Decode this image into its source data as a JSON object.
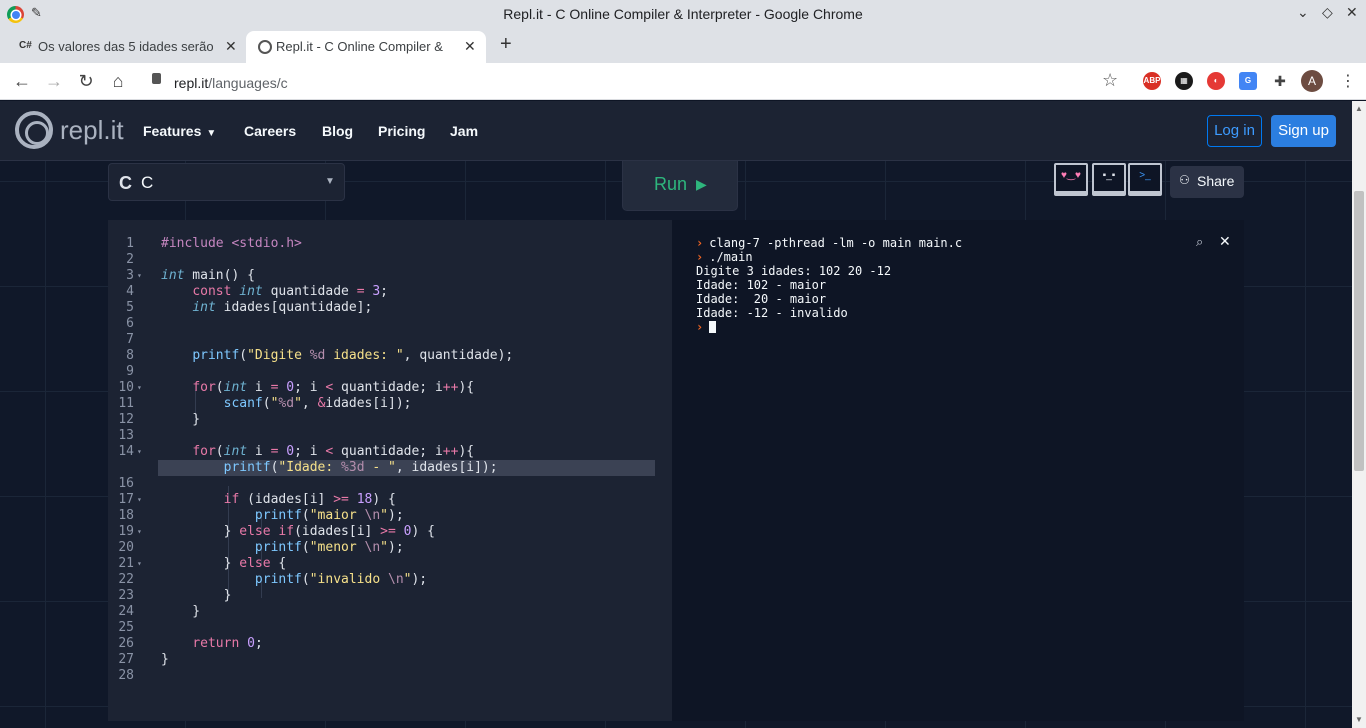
{
  "window": {
    "title": "Repl.it - C Online Compiler & Interpreter - Google Chrome"
  },
  "tabs": [
    {
      "label": "Os valores das 5 idades serão",
      "favicon": "C#"
    },
    {
      "label": "Repl.it - C Online Compiler & I"
    }
  ],
  "address": {
    "host": "repl.it",
    "path": "/languages/c"
  },
  "header": {
    "logo_text": "repl.it",
    "nav": [
      "Features",
      "Careers",
      "Blog",
      "Pricing",
      "Jam"
    ],
    "login": "Log in",
    "signup": "Sign up"
  },
  "toolbar": {
    "language": "C",
    "run": "Run",
    "share": "Share"
  },
  "colors": {
    "accent": "#0079f2",
    "run": "#2eb67d",
    "prompt": "#f26522"
  },
  "editor": {
    "lines": [
      "#include <stdio.h>",
      "",
      "int main() {",
      "    const int quantidade = 3;",
      "    int idades[quantidade];",
      "",
      "",
      "    printf(\"Digite %d idades: \", quantidade);",
      "",
      "    for(int i = 0; i < quantidade; i++){",
      "        scanf(\"%d\", &idades[i]);",
      "    }",
      "",
      "    for(int i = 0; i < quantidade; i++){",
      "        printf(\"Idade: %3d - \", idades[i]);",
      "",
      "        if (idades[i] >= 18) {",
      "            printf(\"maior \\n\");",
      "        } else if(idades[i] >= 0) {",
      "            printf(\"menor \\n\");",
      "        } else {",
      "            printf(\"invalido \\n\");",
      "        }",
      "    }",
      "",
      "    return 0;",
      "}",
      ""
    ],
    "current_line": 15
  },
  "console": {
    "lines": [
      {
        "prompt": true,
        "text": "clang-7 -pthread -lm -o main main.c"
      },
      {
        "prompt": true,
        "text": "./main"
      },
      {
        "prompt": false,
        "text": "Digite 3 idades: 102 20 -12"
      },
      {
        "prompt": false,
        "text": "Idade: 102 - maior"
      },
      {
        "prompt": false,
        "text": "Idade:  20 - maior"
      },
      {
        "prompt": false,
        "text": "Idade: -12 - invalido"
      }
    ]
  }
}
